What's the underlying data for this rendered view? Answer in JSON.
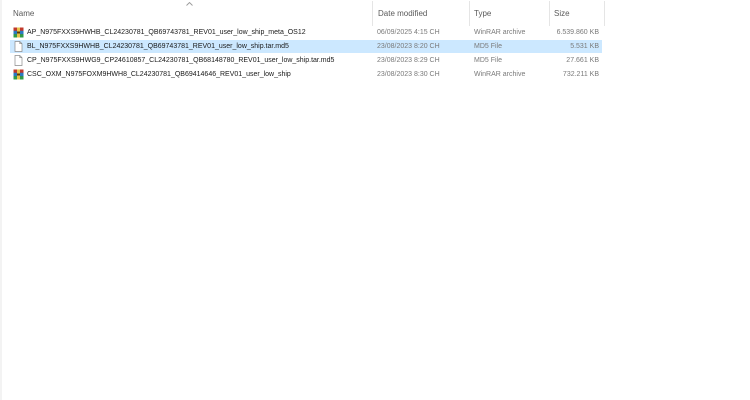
{
  "columns": {
    "name": "Name",
    "date": "Date modified",
    "type": "Type",
    "size": "Size"
  },
  "sort": {
    "column": "name",
    "direction": "ascending"
  },
  "colors": {
    "selection": "#cce8ff",
    "muted_text": "#7a7a7a"
  },
  "files": [
    {
      "name": "AP_N975FXXS9HWHB_CL24230781_QB69743781_REV01_user_low_ship_meta_OS12",
      "date": "06/09/2025 4:15 CH",
      "type": "WinRAR archive",
      "size": "6.539.860 KB",
      "icon": "winrar-archive-icon",
      "selected": false
    },
    {
      "name": "BL_N975FXXS9HWHB_CL24230781_QB69743781_REV01_user_low_ship.tar.md5",
      "date": "23/08/2023 8:20 CH",
      "type": "MD5 File",
      "size": "5.531 KB",
      "icon": "blank-file-icon",
      "selected": true
    },
    {
      "name": "CP_N975FXXS9HWG9_CP24610857_CL24230781_QB68148780_REV01_user_low_ship.tar.md5",
      "date": "23/08/2023 8:29 CH",
      "type": "MD5 File",
      "size": "27.661 KB",
      "icon": "blank-file-icon",
      "selected": false
    },
    {
      "name": "CSC_OXM_N975FOXM9HWH8_CL24230781_QB69414646_REV01_user_low_ship",
      "date": "23/08/2023 8:30 CH",
      "type": "WinRAR archive",
      "size": "732.211 KB",
      "icon": "winrar-archive-icon",
      "selected": false
    }
  ]
}
